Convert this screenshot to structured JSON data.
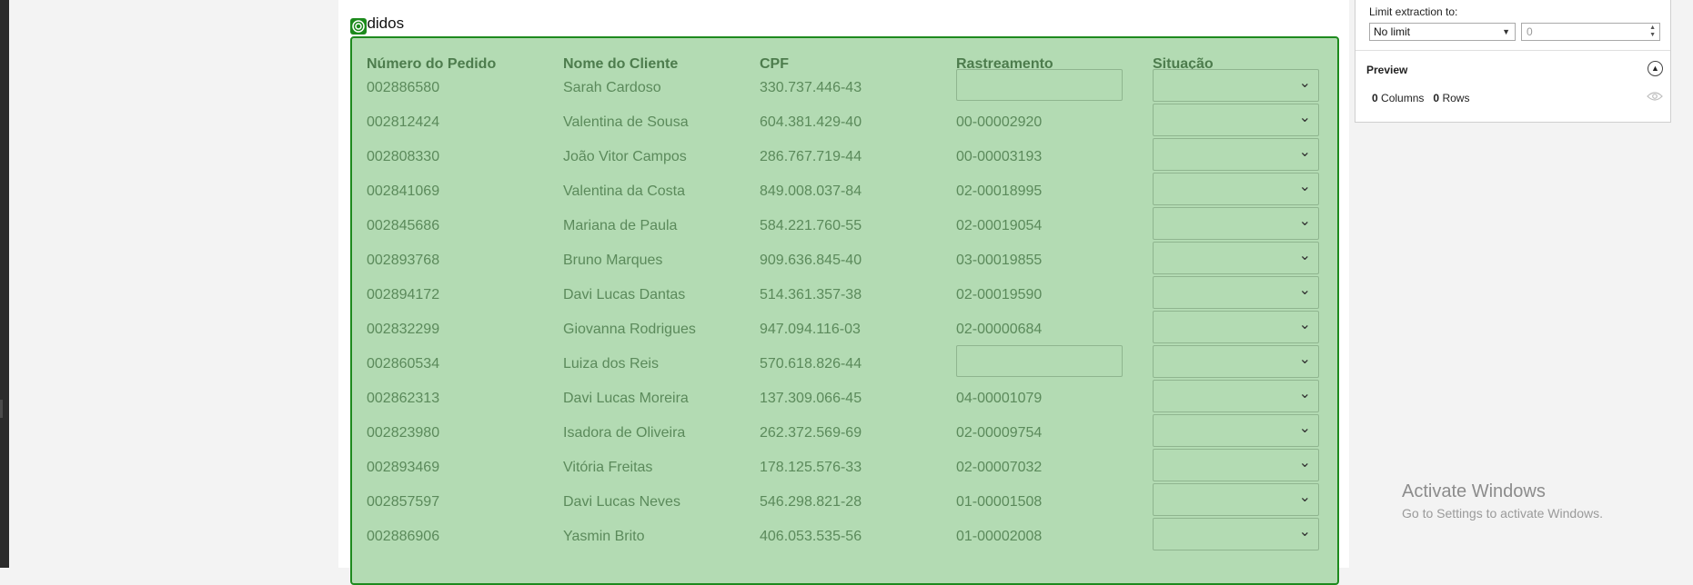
{
  "section": {
    "title": "edidos"
  },
  "table": {
    "headers": [
      "Número do Pedido",
      "Nome do Cliente",
      "CPF",
      "Rastreamento",
      "Situação"
    ],
    "rows": [
      {
        "order": "002886580",
        "name": "Sarah Cardoso",
        "cpf": "330.737.446-43",
        "tracking": "",
        "tracking_input": true
      },
      {
        "order": "002812424",
        "name": "Valentina de Sousa",
        "cpf": "604.381.429-40",
        "tracking": "00-00002920",
        "tracking_input": false
      },
      {
        "order": "002808330",
        "name": "João Vitor Campos",
        "cpf": "286.767.719-44",
        "tracking": "00-00003193",
        "tracking_input": false
      },
      {
        "order": "002841069",
        "name": "Valentina da Costa",
        "cpf": "849.008.037-84",
        "tracking": "02-00018995",
        "tracking_input": false
      },
      {
        "order": "002845686",
        "name": "Mariana de Paula",
        "cpf": "584.221.760-55",
        "tracking": "02-00019054",
        "tracking_input": false
      },
      {
        "order": "002893768",
        "name": "Bruno Marques",
        "cpf": "909.636.845-40",
        "tracking": "03-00019855",
        "tracking_input": false
      },
      {
        "order": "002894172",
        "name": "Davi Lucas Dantas",
        "cpf": "514.361.357-38",
        "tracking": "02-00019590",
        "tracking_input": false
      },
      {
        "order": "002832299",
        "name": "Giovanna Rodrigues",
        "cpf": "947.094.116-03",
        "tracking": "02-00000684",
        "tracking_input": false
      },
      {
        "order": "002860534",
        "name": "Luiza dos Reis",
        "cpf": "570.618.826-44",
        "tracking": "",
        "tracking_input": true
      },
      {
        "order": "002862313",
        "name": "Davi Lucas Moreira",
        "cpf": "137.309.066-45",
        "tracking": "04-00001079",
        "tracking_input": false
      },
      {
        "order": "002823980",
        "name": "Isadora de Oliveira",
        "cpf": "262.372.569-69",
        "tracking": "02-00009754",
        "tracking_input": false
      },
      {
        "order": "002893469",
        "name": "Vitória Freitas",
        "cpf": "178.125.576-33",
        "tracking": "02-00007032",
        "tracking_input": false
      },
      {
        "order": "002857597",
        "name": "Davi Lucas Neves",
        "cpf": "546.298.821-28",
        "tracking": "01-00001508",
        "tracking_input": false
      },
      {
        "order": "002886906",
        "name": "Yasmin Brito",
        "cpf": "406.053.535-56",
        "tracking": "01-00002008",
        "tracking_input": false
      }
    ]
  },
  "panel": {
    "limit_label": "Limit extraction to:",
    "limit_option": "No limit",
    "limit_value": "0",
    "preview_label": "Preview",
    "columns_count": "0",
    "columns_label": "Columns",
    "rows_count": "0",
    "rows_label": "Rows"
  },
  "watermark": {
    "title": "Activate Windows",
    "subtitle": "Go to Settings to activate Windows."
  },
  "colors": {
    "highlight_fill": "#b3dbb3",
    "highlight_border": "#1e8a1e",
    "cell_text": "#5b8a5b",
    "header_text": "#4d7c4d"
  },
  "icons": [
    "target-icon",
    "chevron-down-icon",
    "collapse-up-icon",
    "eye-icon",
    "spin-arrows-icon"
  ]
}
